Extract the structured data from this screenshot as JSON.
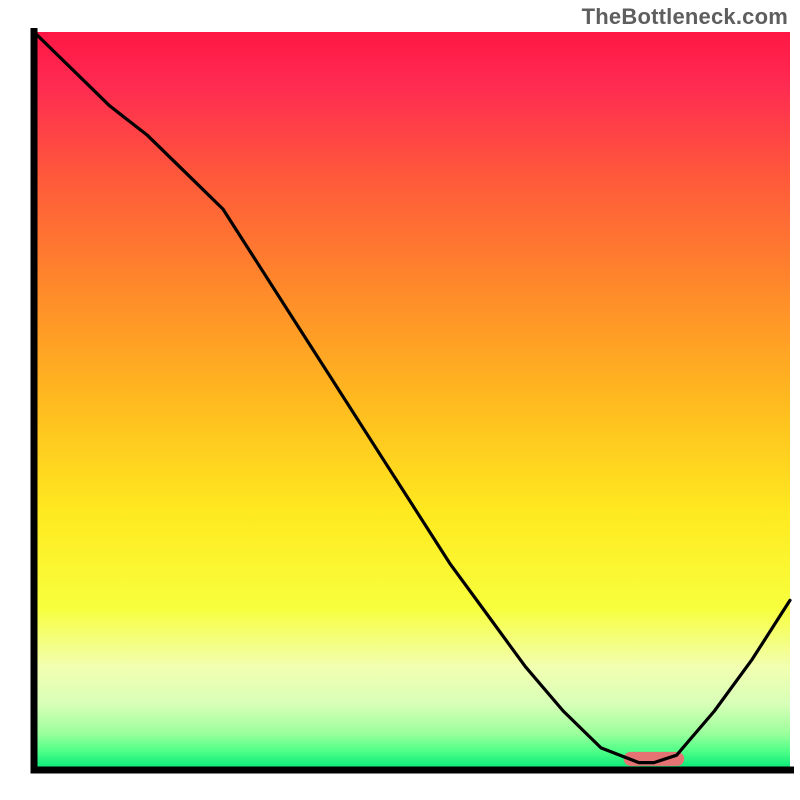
{
  "watermark": "TheBottleneck.com",
  "chart_data": {
    "type": "line",
    "title": "",
    "xlabel": "",
    "ylabel": "",
    "xlim": [
      0,
      100
    ],
    "ylim": [
      0,
      100
    ],
    "series": [
      {
        "name": "curve",
        "x": [
          0,
          5,
          10,
          15,
          20,
          25,
          30,
          35,
          40,
          45,
          50,
          55,
          60,
          65,
          70,
          75,
          80,
          82,
          85,
          90,
          95,
          100
        ],
        "y": [
          100,
          95,
          90,
          86,
          81,
          76,
          68,
          60,
          52,
          44,
          36,
          28,
          21,
          14,
          8,
          3,
          1,
          1,
          2,
          8,
          15,
          23
        ]
      }
    ],
    "marker": {
      "name": "highlight-pill",
      "x_start": 78,
      "x_end": 86,
      "y": 1.5,
      "color": "#e57373"
    },
    "background_gradient": [
      {
        "offset": 0.0,
        "color": "#ff1744"
      },
      {
        "offset": 0.07,
        "color": "#ff2a52"
      },
      {
        "offset": 0.2,
        "color": "#ff5a3a"
      },
      {
        "offset": 0.35,
        "color": "#ff8a2a"
      },
      {
        "offset": 0.5,
        "color": "#ffba1f"
      },
      {
        "offset": 0.65,
        "color": "#ffe91f"
      },
      {
        "offset": 0.78,
        "color": "#f7ff3d"
      },
      {
        "offset": 0.86,
        "color": "#f2ffb0"
      },
      {
        "offset": 0.91,
        "color": "#d8ffb8"
      },
      {
        "offset": 0.95,
        "color": "#9cff9c"
      },
      {
        "offset": 0.975,
        "color": "#4dff88"
      },
      {
        "offset": 1.0,
        "color": "#00e676"
      }
    ],
    "axis_color": "#000000",
    "axis_width": 7
  }
}
